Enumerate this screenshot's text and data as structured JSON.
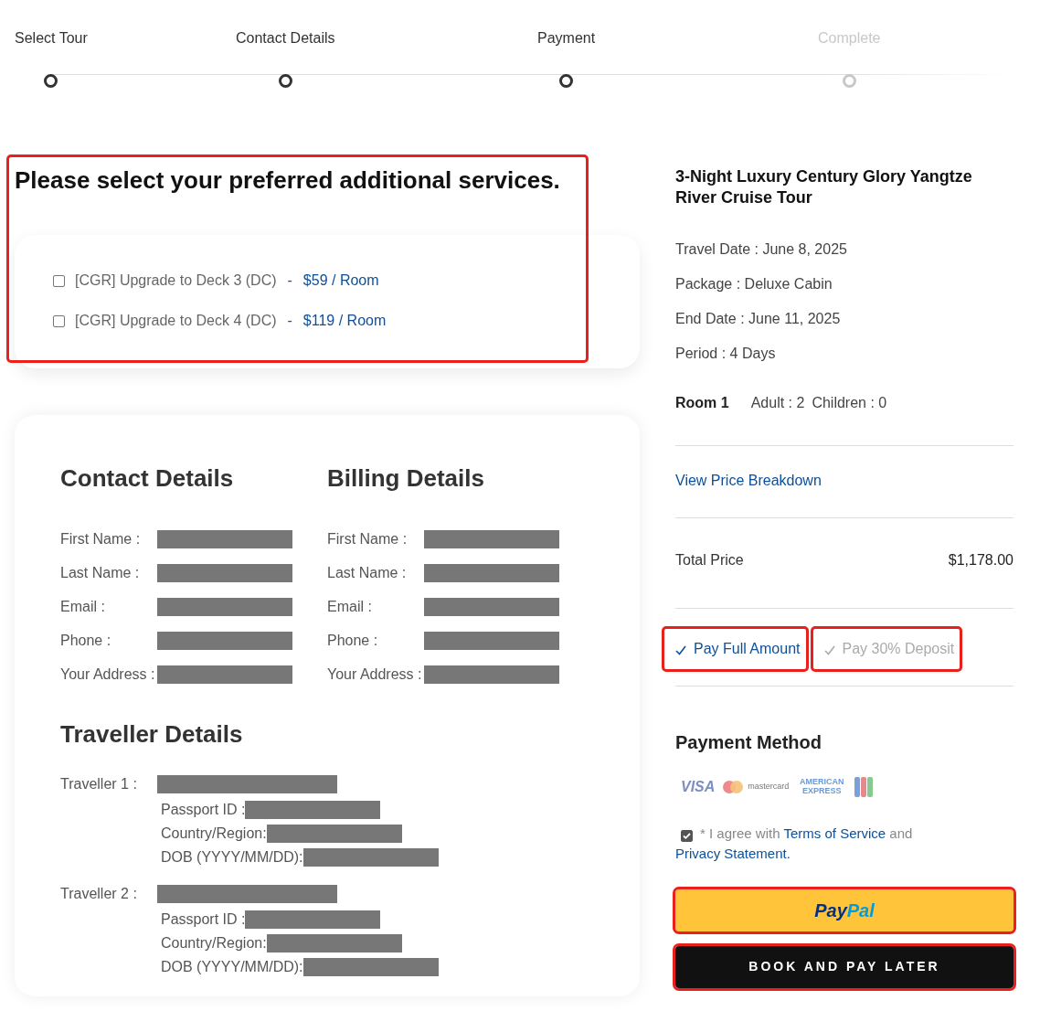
{
  "steps": [
    {
      "label": "Select Tour",
      "done": true
    },
    {
      "label": "Contact Details",
      "done": true
    },
    {
      "label": "Payment",
      "done": true
    },
    {
      "label": "Complete",
      "done": false
    }
  ],
  "services": {
    "title": "Please select your preferred additional services.",
    "highlighted": true,
    "options": [
      {
        "label": "[CGR] Upgrade to Deck 3 (DC)",
        "separator": "-",
        "price": "$59 / Room",
        "checked": false
      },
      {
        "label": "[CGR] Upgrade to Deck 4 (DC)",
        "separator": "-",
        "price": "$119 / Room",
        "checked": false
      }
    ]
  },
  "contact": {
    "title": "Contact Details",
    "fields": [
      "First Name :",
      "Last Name :",
      "Email :",
      "Phone :",
      "Your Address :"
    ]
  },
  "billing": {
    "title": "Billing Details",
    "fields": [
      "First Name :",
      "Last Name :",
      "Email :",
      "Phone :",
      "Your Address :"
    ]
  },
  "travellers": {
    "title": "Traveller Details",
    "items": [
      {
        "label": "Traveller 1 :",
        "fields": [
          "Passport ID :",
          "Country/Region:",
          "DOB (YYYY/MM/DD):"
        ]
      },
      {
        "label": "Traveller 2 :",
        "fields": [
          "Passport ID :",
          "Country/Region:",
          "DOB (YYYY/MM/DD):"
        ]
      }
    ]
  },
  "summary": {
    "title": "3-Night Luxury Century Glory Yangtze River Cruise Tour",
    "details": [
      "Travel Date : June 8, 2025",
      "Package : Deluxe Cabin",
      "End Date : June 11, 2025",
      "Period : 4 Days"
    ],
    "room": {
      "label": "Room 1",
      "adults": "Adult : 2",
      "children": "Children : 0"
    },
    "breakdown_link": "View Price Breakdown",
    "total": {
      "label": "Total Price",
      "value": "$1,178.00"
    },
    "pay_options": [
      {
        "label": "Pay Full Amount",
        "selected": true,
        "highlighted": true
      },
      {
        "label": "Pay 30% Deposit",
        "selected": false,
        "highlighted": true
      }
    ],
    "payment_method": {
      "title": "Payment Method",
      "brands": [
        {
          "kind": "visa",
          "label": "VISA"
        },
        {
          "kind": "mastercard",
          "label": "mastercard"
        },
        {
          "kind": "amex",
          "label": "AMERICAN EXPRESS"
        },
        {
          "kind": "jcb"
        }
      ]
    },
    "agree": {
      "checked": true,
      "prefix": "* I agree with",
      "terms": "Terms of Service",
      "and": "and",
      "privacy": "Privacy Statement."
    },
    "paypal": {
      "parts": [
        "Pay",
        "Pal"
      ],
      "highlighted": true
    },
    "book": {
      "label": "BOOK AND PAY LATER",
      "highlighted": true
    }
  }
}
